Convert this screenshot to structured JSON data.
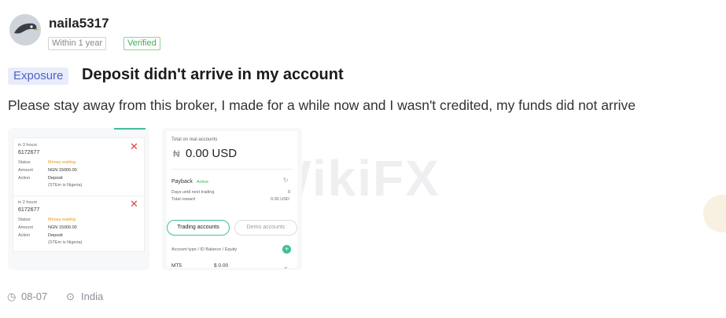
{
  "user": {
    "name": "naila5317",
    "tags": [
      "Within 1 year",
      "Verified"
    ]
  },
  "post": {
    "badge": "Exposure",
    "title": "Deposit didn't arrive in my account",
    "body": "Please stay away from this broker, I made for a while now and I wasn't credited, my funds did not arrive",
    "date": "08-07",
    "location": "India"
  },
  "watermark": "WikiFX",
  "screenshot1": {
    "entries": [
      {
        "time": "in 3 hours",
        "id": "6172677",
        "status_label": "Status",
        "status": "Money waiting",
        "amount_label": "Amount",
        "amount": "NGN 15000.00",
        "action_label": "Action",
        "action": "Deposit",
        "note": "(STEm is Nigeria)"
      },
      {
        "time": "in 2 hours",
        "id": "6172677",
        "status_label": "Status",
        "status": "Money waiting",
        "amount_label": "Amount",
        "amount": "NGN 15000.00",
        "action_label": "Action",
        "action": "Deposit",
        "note": "(STEm is Nigeria)"
      }
    ]
  },
  "screenshot2": {
    "total_label": "Total on real accounts",
    "total": "0.00 USD",
    "payback_label": "Payback",
    "payback_status": "Active",
    "days_label": "Days until next trading",
    "days": "0",
    "reward_label": "Total reward",
    "reward": "0.00 USD",
    "tabs": [
      "Trading accounts",
      "Demo accounts"
    ],
    "cols": "Account type / ID    Balance / Equity",
    "row_type": "MT5",
    "row_balance": "$ 0.00"
  },
  "colors": {
    "accent_blue": "#4d62c9",
    "verified_green": "#3fae55",
    "status_orange": "#e59a1a",
    "cancel_red": "#e0443e"
  }
}
